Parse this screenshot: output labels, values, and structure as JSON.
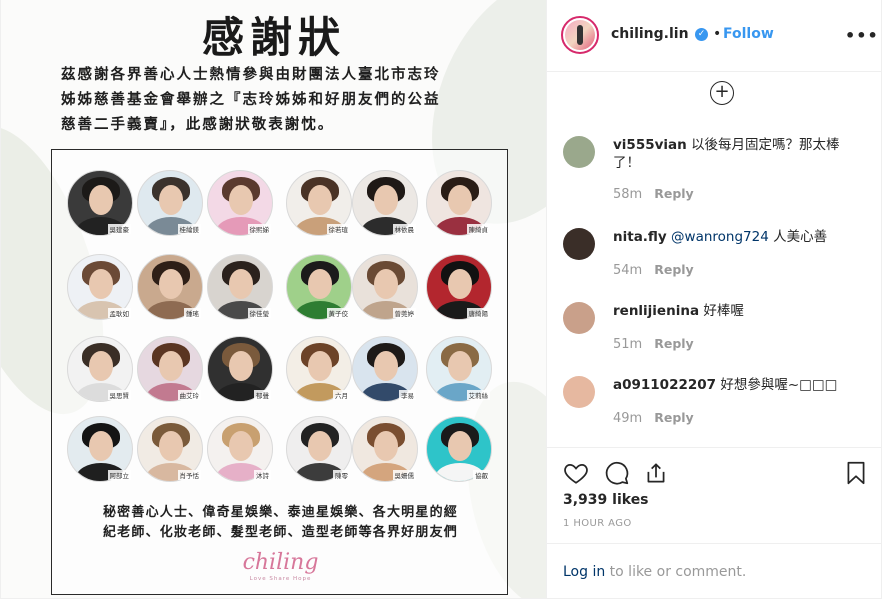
{
  "post": {
    "title": "感謝狀",
    "text_lines": [
      "茲感謝各界善心人士熱情參與由財團法人臺北市志玲",
      "姊姊慈善基金會舉辦之『志玲姊姊和好朋友們的公益",
      "慈善二手義賣』，此感謝狀敬表謝忱。"
    ],
    "people": [
      {
        "name": "吳建豪",
        "bg": "#3a3a3a",
        "hair": "#1c1a18",
        "shirt": "#222222"
      },
      {
        "name": "桂綸鎂",
        "bg": "#dfe9ef",
        "hair": "#3b322c",
        "shirt": "#7a8a96"
      },
      {
        "name": "徐熙娣",
        "bg": "#f3d9e6",
        "hair": "#5a3a2e",
        "shirt": "#e59ab8"
      },
      {
        "name": "徐若瑄",
        "bg": "#f1eeea",
        "hair": "#4a3326",
        "shirt": "#c9a07a"
      },
      {
        "name": "林依晨",
        "bg": "#ece8e4",
        "hair": "#1f1916",
        "shirt": "#2c2c2c"
      },
      {
        "name": "陳綺貞",
        "bg": "#efe5e0",
        "hair": "#2a1d16",
        "shirt": "#9a3040"
      },
      {
        "name": "孟耿如",
        "bg": "#eef1f5",
        "hair": "#6b4a36",
        "shirt": "#d8c4b0"
      },
      {
        "name": "鍾瑤",
        "bg": "#c9a98e",
        "hair": "#2e1f17",
        "shirt": "#8e6b52"
      },
      {
        "name": "徐佳瑩",
        "bg": "#d8d4cf",
        "hair": "#2b221d",
        "shirt": "#4a4a4a"
      },
      {
        "name": "黃子佼",
        "bg": "#9fd08a",
        "hair": "#1b1b1b",
        "shirt": "#2e7d32"
      },
      {
        "name": "曾莞婷",
        "bg": "#e9e1da",
        "hair": "#6a4a34",
        "shirt": "#bfa48c"
      },
      {
        "name": "唐綺陽",
        "bg": "#b3262e",
        "hair": "#111111",
        "shirt": "#1a1a1a"
      },
      {
        "name": "吳思賢",
        "bg": "#f2f2f2",
        "hair": "#3a2e26",
        "shirt": "#dcdcdc"
      },
      {
        "name": "曲艾玲",
        "bg": "#e6d8e0",
        "hair": "#5a3522",
        "shirt": "#c27a90"
      },
      {
        "name": "郁聲",
        "bg": "#303030",
        "hair": "#7a5a3c",
        "shirt": "#222222"
      },
      {
        "name": "六月",
        "bg": "#f3eee6",
        "hair": "#6c4328",
        "shirt": "#c29a5e"
      },
      {
        "name": "李易",
        "bg": "#d9e4ee",
        "hair": "#1e1a18",
        "shirt": "#324a6a"
      },
      {
        "name": "艾莉絲",
        "bg": "#e2eef3",
        "hair": "#8a6a44",
        "shirt": "#6aa6c8"
      },
      {
        "name": "阿部立",
        "bg": "#e3ebef",
        "hair": "#141414",
        "shirt": "#1f1f1f"
      },
      {
        "name": "肖予恬",
        "bg": "#f1ebe4",
        "hair": "#7a5a3a",
        "shirt": "#d8b8a0"
      },
      {
        "name": "沐詩",
        "bg": "#f4f1ef",
        "hair": "#c8a070",
        "shirt": "#e6b0c8"
      },
      {
        "name": "陳零",
        "bg": "#efeeee",
        "hair": "#222222",
        "shirt": "#3c3c3c"
      },
      {
        "name": "吳姍儒",
        "bg": "#f0e8e0",
        "hair": "#7a4e30",
        "shirt": "#d4a57e"
      },
      {
        "name": "協叡",
        "bg": "#2ec4c9",
        "hair": "#1a1a1a",
        "shirt": "#f5f5f5"
      }
    ],
    "bottom_lines": [
      "秘密善心人士、偉奇星娛樂、泰迪星娛樂、各大明星的經",
      "紀老師、化妝老師、髮型老師、造型老師等各界好朋友們"
    ],
    "brand": "chiling",
    "brand_sub": "Love Share Hope"
  },
  "header": {
    "username": "chiling.lin",
    "separator": "•",
    "follow_label": "Follow",
    "more_label": "•••",
    "verified_mark": "✓"
  },
  "comments": [
    {
      "user": "vi555vian",
      "text": "以後每月固定嗎？那太棒了！",
      "mention": "",
      "time": "58m",
      "reply": "Reply",
      "avatar_color": "#9aa88c"
    },
    {
      "user": "nita.fly",
      "text": " 人美心善",
      "mention": "@wanrong724",
      "time": "54m",
      "reply": "Reply",
      "avatar_color": "#3a2e28"
    },
    {
      "user": "renlijienina",
      "text": "好棒喔",
      "mention": "",
      "time": "51m",
      "reply": "Reply",
      "avatar_color": "#c9a08a"
    },
    {
      "user": "a0911022207",
      "text": "好想參與喔~□□□",
      "mention": "",
      "time": "49m",
      "reply": "Reply",
      "avatar_color": "#e6b8a0"
    }
  ],
  "load_more_label": "+",
  "actions": {
    "likes": "3,939 likes",
    "posted": "1 HOUR AGO"
  },
  "login": {
    "link": "Log in",
    "rest": " to like or comment."
  }
}
